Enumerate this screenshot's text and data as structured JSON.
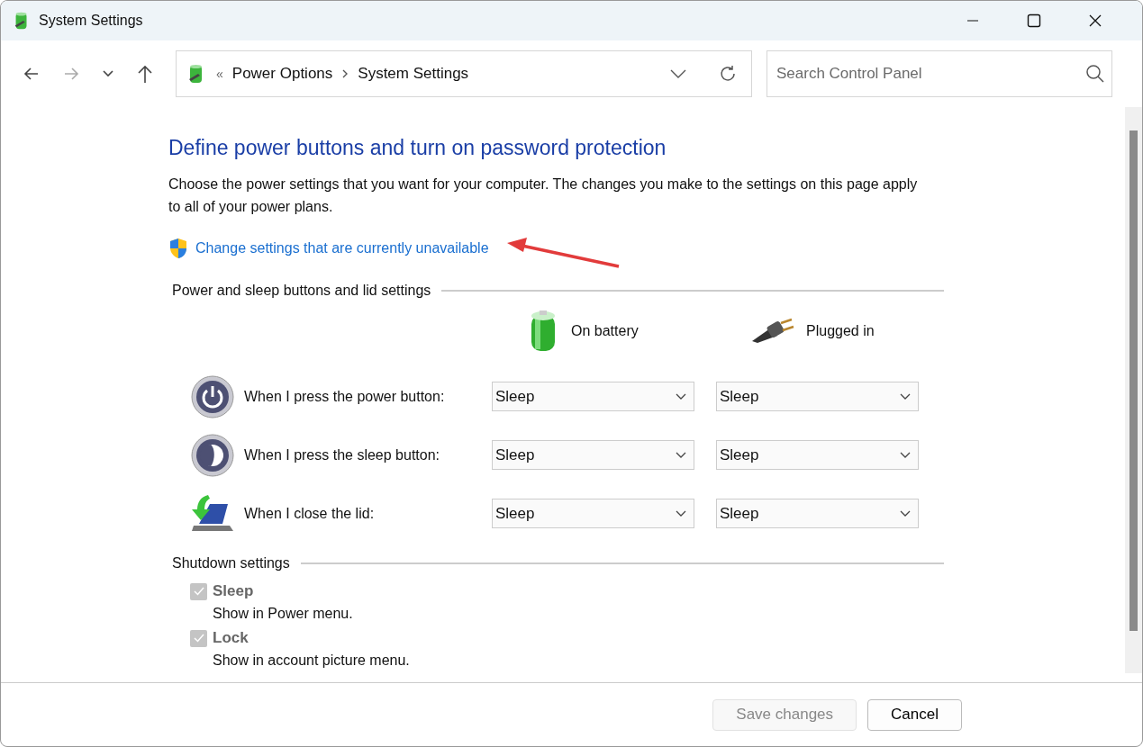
{
  "window": {
    "title": "System Settings"
  },
  "nav": {
    "back_disabled": false,
    "forward_disabled": true
  },
  "address": {
    "overflow": "«",
    "crumbs": [
      "Power Options",
      "System Settings"
    ]
  },
  "search": {
    "placeholder": "Search Control Panel"
  },
  "heading": "Define power buttons and turn on password protection",
  "description": "Choose the power settings that you want for your computer. The changes you make to the settings on this page apply to all of your power plans.",
  "admin_link": "Change settings that are currently unavailable",
  "buttons_section": {
    "title": "Power and sleep buttons and lid settings",
    "columns": [
      {
        "label": "On battery",
        "kind": "battery"
      },
      {
        "label": "Plugged in",
        "kind": "plug"
      }
    ],
    "rows": [
      {
        "kind": "power",
        "label": "When I press the power button:",
        "values": [
          "Sleep",
          "Sleep"
        ]
      },
      {
        "kind": "sleep",
        "label": "When I press the sleep button:",
        "values": [
          "Sleep",
          "Sleep"
        ]
      },
      {
        "kind": "lid",
        "label": "When I close the lid:",
        "values": [
          "Sleep",
          "Sleep"
        ]
      }
    ]
  },
  "shutdown_section": {
    "title": "Shutdown settings",
    "items": [
      {
        "label": "Sleep",
        "description": "Show in Power menu.",
        "checked": true,
        "disabled": true
      },
      {
        "label": "Lock",
        "description": "Show in account picture menu.",
        "checked": true,
        "disabled": true
      }
    ]
  },
  "buttons": [
    {
      "label": "Save changes",
      "disabled": true
    },
    {
      "label": "Cancel",
      "disabled": false
    }
  ]
}
